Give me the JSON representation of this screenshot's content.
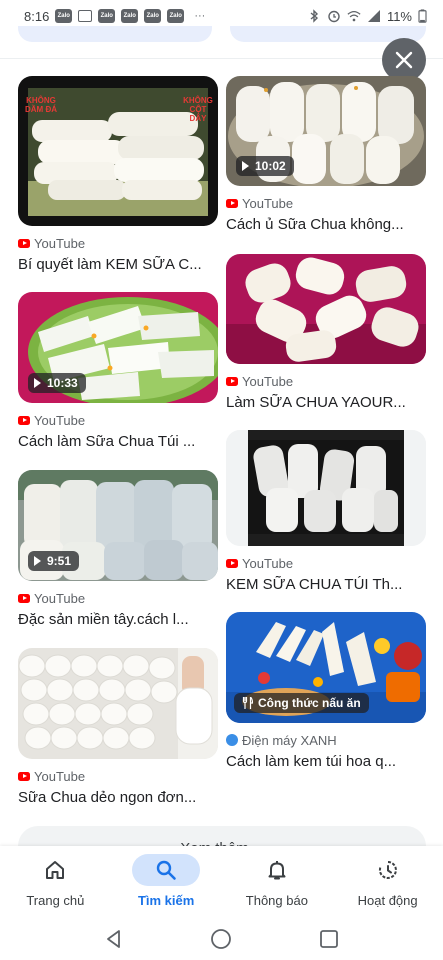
{
  "status_bar": {
    "time": "8:16",
    "notification_icons": [
      "Zalo",
      "message-icon",
      "Zalo",
      "Zalo",
      "Zalo",
      "Zalo"
    ],
    "more": "···",
    "battery": "11%"
  },
  "results": [
    {
      "source": "YouTube",
      "title": "Bí quyết làm KEM SỮA C...",
      "duration": "",
      "overlay_left": "KHÔNG DẦM ĐÁ",
      "overlay_right": "KHÔNG CỘT DÂY"
    },
    {
      "source": "YouTube",
      "title": "Cách ủ Sữa Chua không...",
      "duration": "10:02"
    },
    {
      "source": "YouTube",
      "title": "Cách làm Sữa Chua Túi ...",
      "duration": "10:33"
    },
    {
      "source": "YouTube",
      "title": "Làm SỮA CHUA YAOUR...",
      "duration": ""
    },
    {
      "source": "YouTube",
      "title": "Đặc sản miền tây.cách l...",
      "duration": "9:51"
    },
    {
      "source": "YouTube",
      "title": "KEM SỮA CHUA TÚI Th...",
      "duration": ""
    },
    {
      "source": "YouTube",
      "title": "Sữa Chua dẻo ngon đơn...",
      "duration": ""
    },
    {
      "source": "Điện máy XANH",
      "title": "Cách làm kem túi hoa q...",
      "badge": "Công thức nấu ăn"
    }
  ],
  "see_more": "Xem thêm",
  "bottom_nav": [
    {
      "label": "Trang chủ",
      "icon": "home-icon",
      "active": false
    },
    {
      "label": "Tìm kiếm",
      "icon": "search-icon",
      "active": true
    },
    {
      "label": "Thông báo",
      "icon": "bell-icon",
      "active": false
    },
    {
      "label": "Hoạt động",
      "icon": "history-icon",
      "active": false
    }
  ],
  "colors": {
    "accent": "#1a73e8",
    "active_pill": "#d2e3fc",
    "youtube_red": "#ff0000",
    "close_button": "#5f6368"
  }
}
